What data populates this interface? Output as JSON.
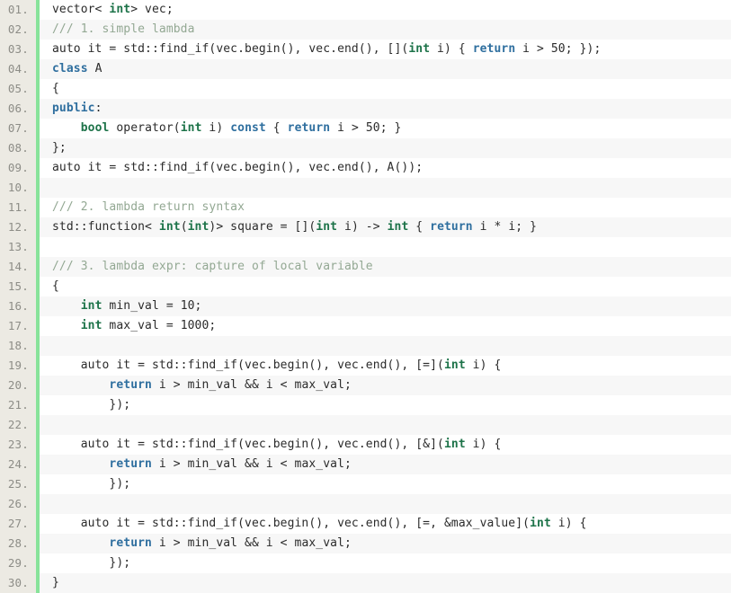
{
  "editor": {
    "language": "cpp",
    "line_number_suffix": ".",
    "first_line": 1,
    "last_line": 30,
    "colors": {
      "background": "#ffffff",
      "alt_row_background": "#f7f7f7",
      "gutter_background": "#eceae3",
      "gutter_text": "#8d8d87",
      "gutter_accent_bar": "#88e39a",
      "code_text": "#2b2b2b",
      "keyword": "#2f6f9f",
      "type": "#1d7349",
      "comment": "#93a893"
    }
  },
  "lines": [
    {
      "num": "01.",
      "tokens": [
        {
          "t": "vector< ",
          "c": "txt"
        },
        {
          "t": "int",
          "c": "type"
        },
        {
          "t": "> vec;",
          "c": "txt"
        }
      ]
    },
    {
      "num": "02.",
      "tokens": [
        {
          "t": "/// 1. simple lambda",
          "c": "cmt"
        }
      ]
    },
    {
      "num": "03.",
      "tokens": [
        {
          "t": "auto it = std::find_if(vec.begin(), vec.end(), [](",
          "c": "txt"
        },
        {
          "t": "int",
          "c": "type"
        },
        {
          "t": " i) { ",
          "c": "txt"
        },
        {
          "t": "return",
          "c": "kw"
        },
        {
          "t": " i > 50; });",
          "c": "txt"
        }
      ]
    },
    {
      "num": "04.",
      "tokens": [
        {
          "t": "class",
          "c": "kw"
        },
        {
          "t": " A",
          "c": "txt"
        }
      ]
    },
    {
      "num": "05.",
      "tokens": [
        {
          "t": "{",
          "c": "txt"
        }
      ]
    },
    {
      "num": "06.",
      "tokens": [
        {
          "t": "public",
          "c": "kw"
        },
        {
          "t": ":",
          "c": "txt"
        }
      ]
    },
    {
      "num": "07.",
      "tokens": [
        {
          "t": "    ",
          "c": "txt"
        },
        {
          "t": "bool",
          "c": "type"
        },
        {
          "t": " operator(",
          "c": "txt"
        },
        {
          "t": "int",
          "c": "type"
        },
        {
          "t": " i) ",
          "c": "txt"
        },
        {
          "t": "const",
          "c": "kw"
        },
        {
          "t": " { ",
          "c": "txt"
        },
        {
          "t": "return",
          "c": "kw"
        },
        {
          "t": " i > 50; }",
          "c": "txt"
        }
      ]
    },
    {
      "num": "08.",
      "tokens": [
        {
          "t": "};",
          "c": "txt"
        }
      ]
    },
    {
      "num": "09.",
      "tokens": [
        {
          "t": "auto it = std::find_if(vec.begin(), vec.end(), A());",
          "c": "txt"
        }
      ]
    },
    {
      "num": "10.",
      "tokens": []
    },
    {
      "num": "11.",
      "tokens": [
        {
          "t": "/// 2. lambda return syntax",
          "c": "cmt"
        }
      ]
    },
    {
      "num": "12.",
      "tokens": [
        {
          "t": "std::function< ",
          "c": "txt"
        },
        {
          "t": "int",
          "c": "type"
        },
        {
          "t": "(",
          "c": "txt"
        },
        {
          "t": "int",
          "c": "type"
        },
        {
          "t": ")> square = [](",
          "c": "txt"
        },
        {
          "t": "int",
          "c": "type"
        },
        {
          "t": " i) -> ",
          "c": "txt"
        },
        {
          "t": "int",
          "c": "type"
        },
        {
          "t": " { ",
          "c": "txt"
        },
        {
          "t": "return",
          "c": "kw"
        },
        {
          "t": " i * i; }",
          "c": "txt"
        }
      ]
    },
    {
      "num": "13.",
      "tokens": []
    },
    {
      "num": "14.",
      "tokens": [
        {
          "t": "/// 3. lambda expr: capture of local variable",
          "c": "cmt"
        }
      ]
    },
    {
      "num": "15.",
      "tokens": [
        {
          "t": "{",
          "c": "txt"
        }
      ]
    },
    {
      "num": "16.",
      "tokens": [
        {
          "t": "    ",
          "c": "txt"
        },
        {
          "t": "int",
          "c": "type"
        },
        {
          "t": " min_val = 10;",
          "c": "txt"
        }
      ]
    },
    {
      "num": "17.",
      "tokens": [
        {
          "t": "    ",
          "c": "txt"
        },
        {
          "t": "int",
          "c": "type"
        },
        {
          "t": " max_val = 1000;",
          "c": "txt"
        }
      ]
    },
    {
      "num": "18.",
      "tokens": []
    },
    {
      "num": "19.",
      "tokens": [
        {
          "t": "    auto it = std::find_if(vec.begin(), vec.end(), [=](",
          "c": "txt"
        },
        {
          "t": "int",
          "c": "type"
        },
        {
          "t": " i) {",
          "c": "txt"
        }
      ]
    },
    {
      "num": "20.",
      "tokens": [
        {
          "t": "        ",
          "c": "txt"
        },
        {
          "t": "return",
          "c": "kw"
        },
        {
          "t": " i > min_val && i < max_val;",
          "c": "txt"
        }
      ]
    },
    {
      "num": "21.",
      "tokens": [
        {
          "t": "        });",
          "c": "txt"
        }
      ]
    },
    {
      "num": "22.",
      "tokens": []
    },
    {
      "num": "23.",
      "tokens": [
        {
          "t": "    auto it = std::find_if(vec.begin(), vec.end(), [&](",
          "c": "txt"
        },
        {
          "t": "int",
          "c": "type"
        },
        {
          "t": " i) {",
          "c": "txt"
        }
      ]
    },
    {
      "num": "24.",
      "tokens": [
        {
          "t": "        ",
          "c": "txt"
        },
        {
          "t": "return",
          "c": "kw"
        },
        {
          "t": " i > min_val && i < max_val;",
          "c": "txt"
        }
      ]
    },
    {
      "num": "25.",
      "tokens": [
        {
          "t": "        });",
          "c": "txt"
        }
      ]
    },
    {
      "num": "26.",
      "tokens": []
    },
    {
      "num": "27.",
      "tokens": [
        {
          "t": "    auto it = std::find_if(vec.begin(), vec.end(), [=, &max_value](",
          "c": "txt"
        },
        {
          "t": "int",
          "c": "type"
        },
        {
          "t": " i) {",
          "c": "txt"
        }
      ]
    },
    {
      "num": "28.",
      "tokens": [
        {
          "t": "        ",
          "c": "txt"
        },
        {
          "t": "return",
          "c": "kw"
        },
        {
          "t": " i > min_val && i < max_val;",
          "c": "txt"
        }
      ]
    },
    {
      "num": "29.",
      "tokens": [
        {
          "t": "        });",
          "c": "txt"
        }
      ]
    },
    {
      "num": "30.",
      "tokens": [
        {
          "t": "}",
          "c": "txt"
        }
      ]
    }
  ]
}
